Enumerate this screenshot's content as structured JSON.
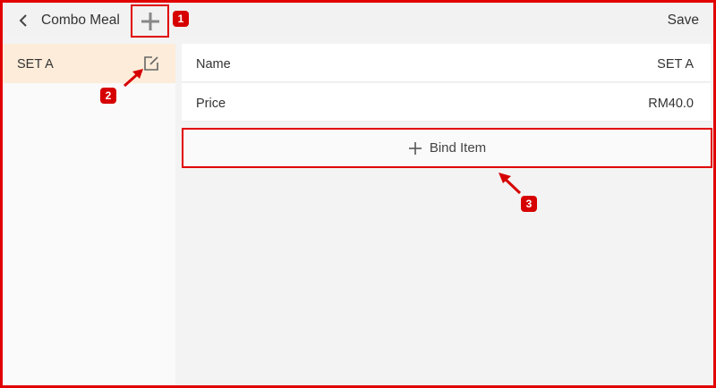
{
  "header": {
    "title": "Combo Meal",
    "save_label": "Save"
  },
  "sidebar": {
    "items": [
      {
        "label": "SET A",
        "selected": true
      }
    ]
  },
  "details": {
    "name_label": "Name",
    "name_value": "SET A",
    "price_label": "Price",
    "price_value": "RM40.0"
  },
  "bind_item": {
    "label": "Bind Item"
  },
  "annotations": {
    "badge_1": "1",
    "badge_2": "2",
    "badge_3": "3"
  },
  "colors": {
    "annotation_red": "#e10000",
    "selected_bg": "#fdecd9",
    "toolbar_bg": "#f2f2f2"
  },
  "icons": {
    "back": "chevron-left-icon",
    "add": "plus-icon",
    "edit": "edit-icon",
    "bind_plus": "plus-icon"
  }
}
